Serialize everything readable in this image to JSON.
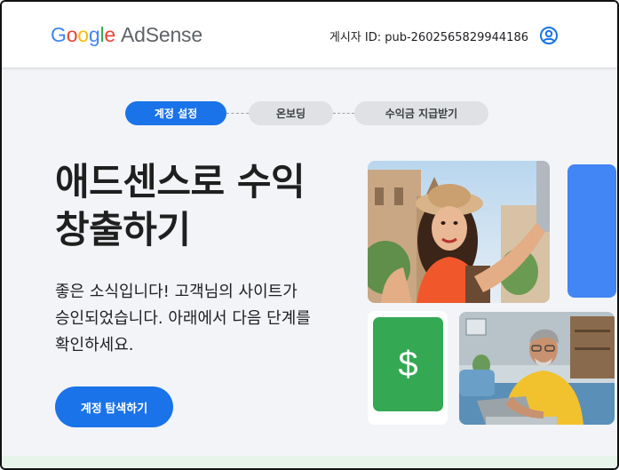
{
  "header": {
    "logo_brand": "Google",
    "logo_product": "AdSense",
    "publisher_id": "게시자 ID: pub-2602565829944186",
    "account_icon": "account-circle-icon"
  },
  "stepper": {
    "steps": [
      {
        "label": "계정 설정",
        "state": "active"
      },
      {
        "label": "온보딩",
        "state": "inactive"
      },
      {
        "label": "수익금 지급받기",
        "state": "inactive"
      }
    ]
  },
  "hero": {
    "title_line1": "애드센스로 수익",
    "title_line2": "창출하기",
    "body_line1": "좋은 소식입니다! 고객님의 사이트가",
    "body_line2": "승인되었습니다. 아래에서 다음 단계를",
    "body_line3": "확인하세요.",
    "cta_label": "계정 탐색하기"
  },
  "collage": {
    "dollar_symbol": "$",
    "colors": {
      "accent": "#1a73e8",
      "tile_blue": "#4285f4",
      "tile_green": "#34a853"
    }
  }
}
